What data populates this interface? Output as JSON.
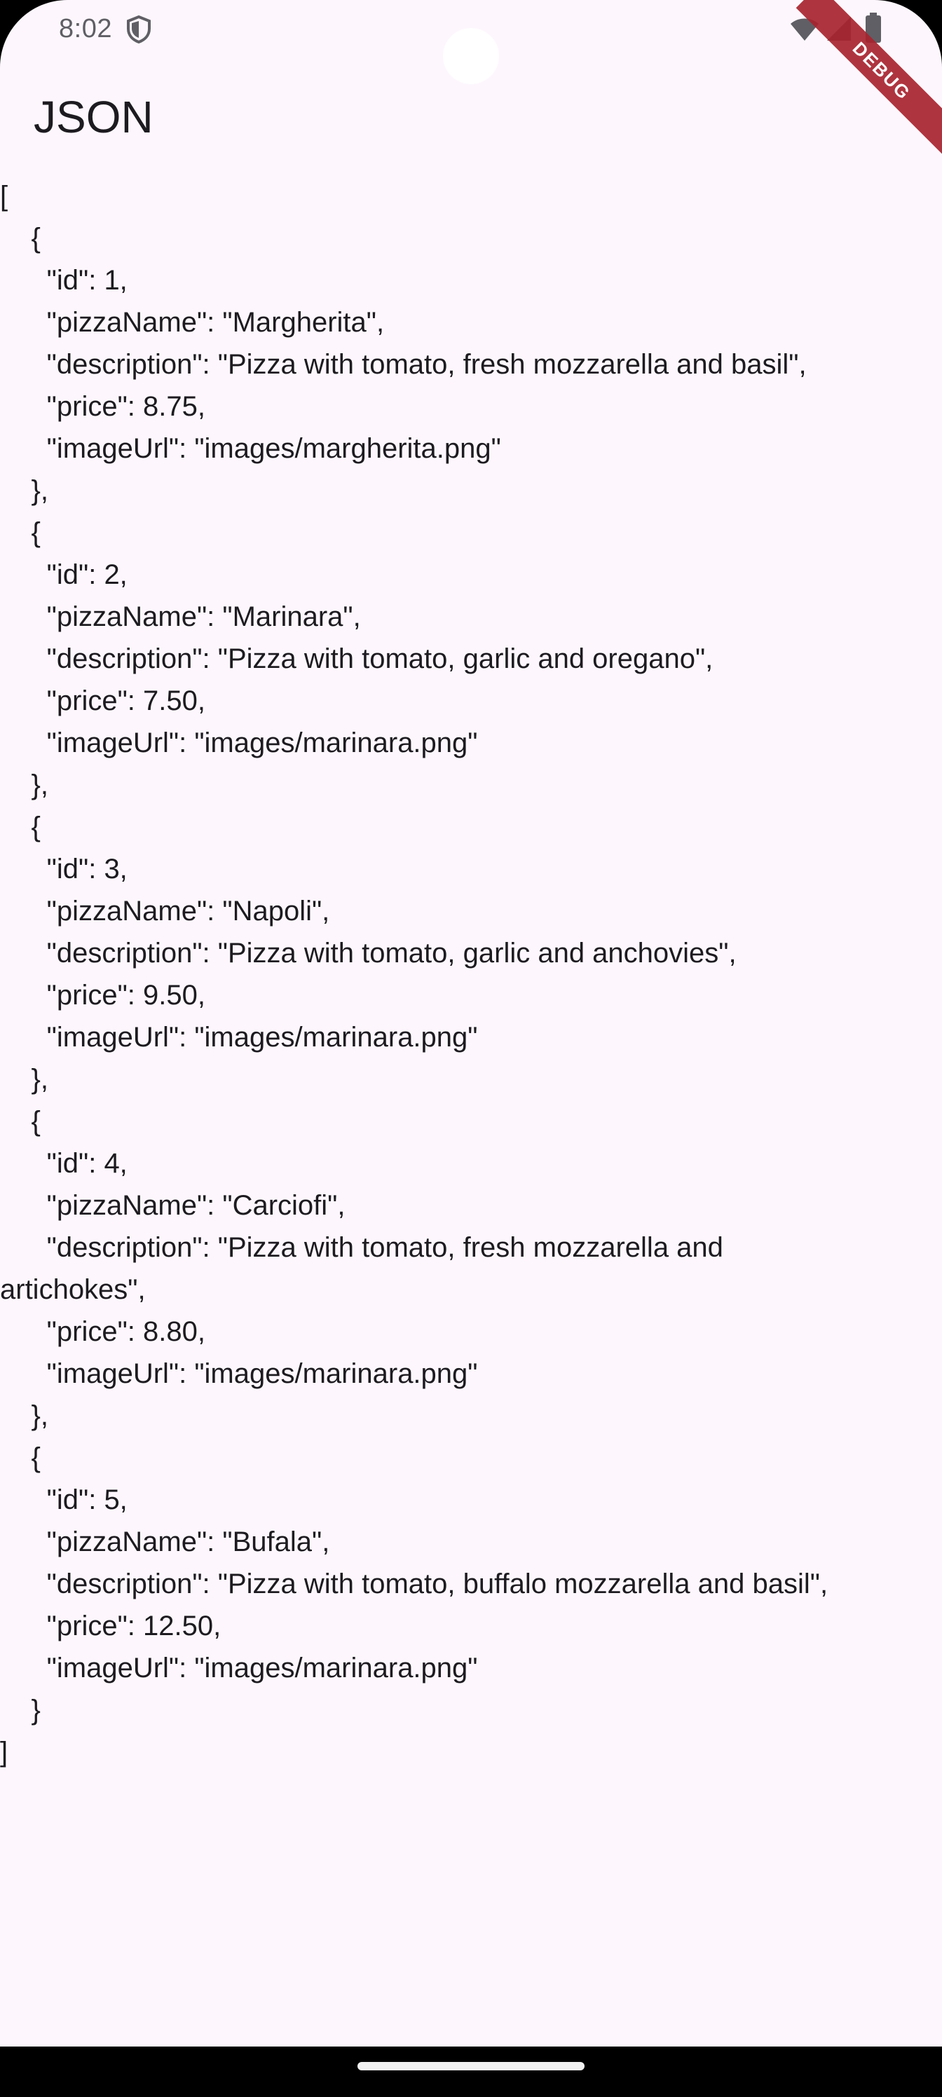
{
  "status_bar": {
    "time": "8:02",
    "icons": [
      "shield-icon",
      "wifi-icon",
      "signal-icon",
      "battery-icon"
    ]
  },
  "debug_banner": "DEBUG",
  "app_bar": {
    "title": "JSON"
  },
  "json_lines": [
    "[",
    "    {",
    "      \"id\": 1,",
    "      \"pizzaName\": \"Margherita\",",
    "      \"description\": \"Pizza with tomato, fresh mozzarella and basil\",",
    "      \"price\": 8.75,",
    "      \"imageUrl\": \"images/margherita.png\"",
    "    },",
    "    {",
    "      \"id\": 2,",
    "      \"pizzaName\": \"Marinara\",",
    "      \"description\": \"Pizza with tomato, garlic and oregano\",",
    "      \"price\": 7.50,",
    "      \"imageUrl\": \"images/marinara.png\"",
    "    },",
    "    {",
    "      \"id\": 3,",
    "      \"pizzaName\": \"Napoli\",",
    "      \"description\": \"Pizza with tomato, garlic and anchovies\",",
    "      \"price\": 9.50,",
    "      \"imageUrl\": \"images/marinara.png\"",
    "    },",
    "    {",
    "      \"id\": 4,",
    "      \"pizzaName\": \"Carciofi\",",
    "      \"description\": \"Pizza with tomato, fresh mozzarella and",
    "artichokes\",",
    "      \"price\": 8.80,",
    "      \"imageUrl\": \"images/marinara.png\"",
    "    },",
    "    {",
    "      \"id\": 5,",
    "      \"pizzaName\": \"Bufala\",",
    "      \"description\": \"Pizza with tomato, buffalo mozzarella and basil\",",
    "      \"price\": 12.50,",
    "      \"imageUrl\": \"images/marinara.png\"",
    "    }",
    "]"
  ],
  "colors": {
    "background": "#fdf7fd",
    "text": "#1d1b20",
    "status_text": "#5f5f65",
    "debug_banner": "#a8242f"
  }
}
